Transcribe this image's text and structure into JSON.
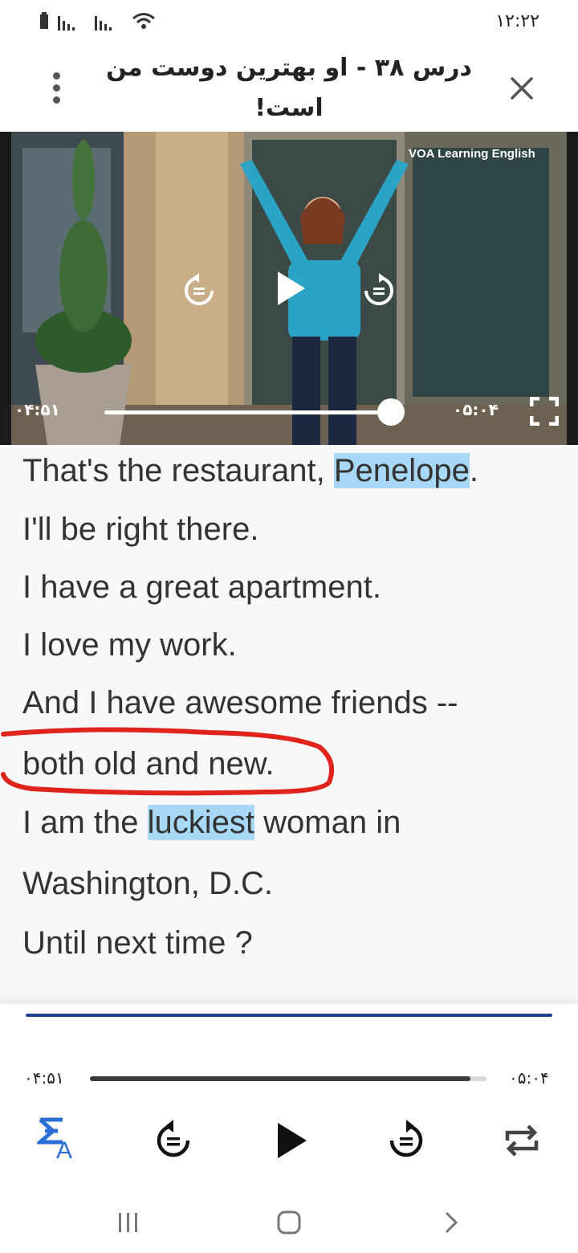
{
  "status_bar": {
    "time": "۱۲:۲۲"
  },
  "header": {
    "title": "درس ۳۸ - او بهترین دوست من است!"
  },
  "video": {
    "overlay_brand": "VOA Learning English",
    "current_time": "۰۴:۵۱",
    "duration": "۰۵:۰۴",
    "progress": 0.96
  },
  "transcript": {
    "lines": [
      {
        "before": "That's the restaurant, ",
        "highlight": "Penelope",
        "after": "."
      },
      {
        "text": "I'll be right there."
      },
      {
        "text": "I have a great apartment."
      },
      {
        "text": "I love my work."
      },
      {
        "text": "And I have awesome friends --"
      },
      {
        "text": "both old and new."
      },
      {
        "before": "I am the ",
        "highlight": "luckiest",
        "after": " woman in"
      },
      {
        "text": "Washington, D.C."
      },
      {
        "text": "Until next time ?"
      }
    ]
  },
  "player": {
    "current_time": "۰۴:۵۱",
    "duration": "۰۵:۰۴",
    "progress": 0.96,
    "icons": [
      "translate-icon",
      "replay-5-icon",
      "play-icon",
      "forward-5-icon",
      "repeat-icon"
    ]
  },
  "colors": {
    "highlight": "#a7d8f5",
    "accent": "#2b6fd6",
    "scribble": "#e0241c"
  }
}
